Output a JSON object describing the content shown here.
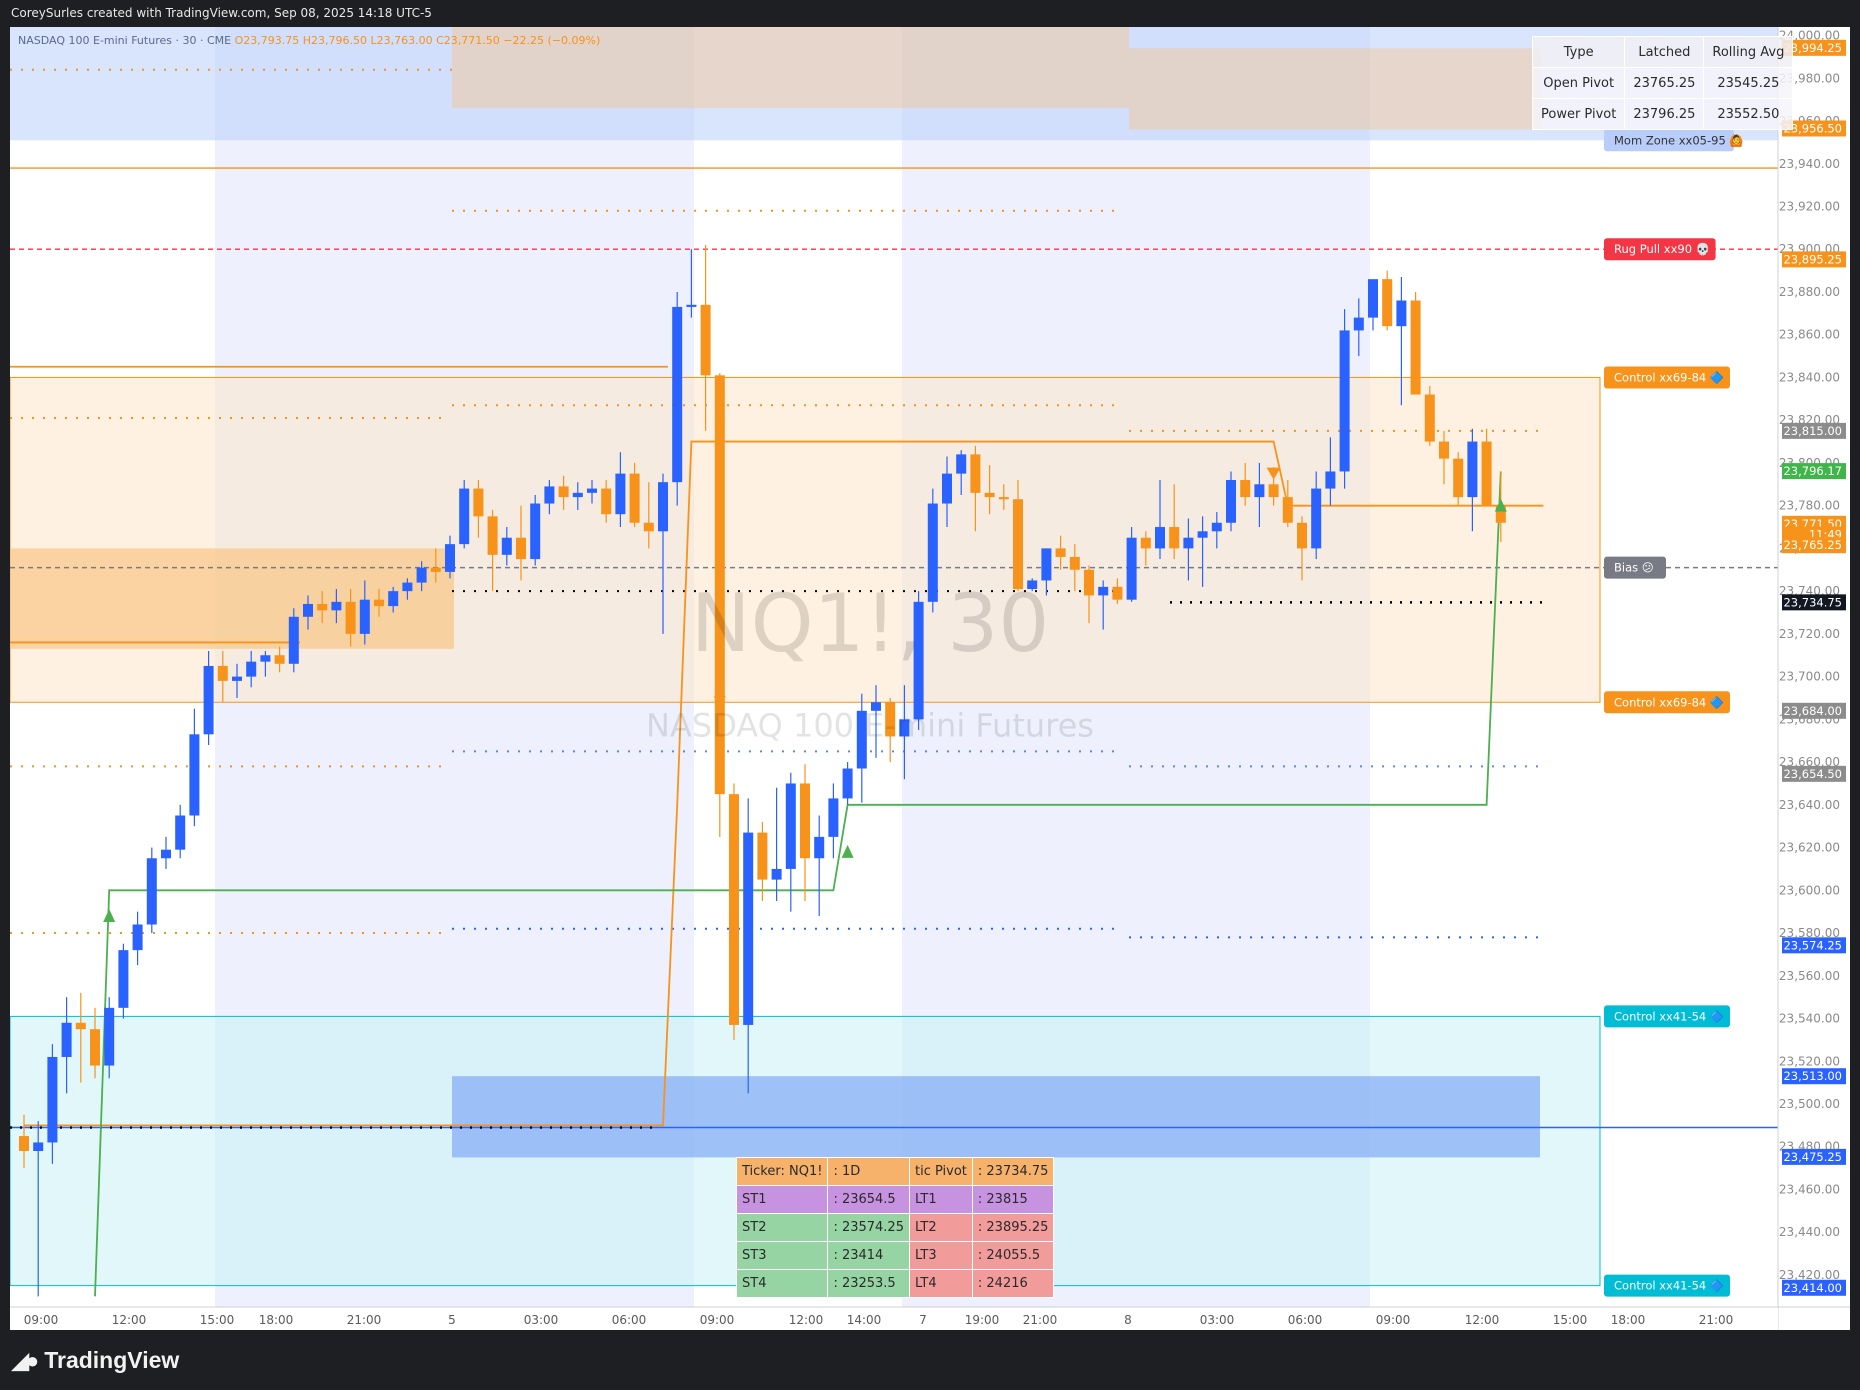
{
  "header": {
    "attribution": "CoreySurles created with TradingView.com, Sep 08, 2025 14:18 UTC-5",
    "brand": "TradingView"
  },
  "legend": {
    "title": "NASDAQ 100 E-mini Futures · 30 · CME",
    "open": "O23,793.75",
    "high": "H23,796.50",
    "low": "L23,763.00",
    "close": "C23,771.50",
    "change": "−22.25 (−0.09%)"
  },
  "watermark": {
    "symbol": "NQ1!, 30",
    "name": "NASDAQ 100 E-mini Futures"
  },
  "pivot_table": {
    "headers": [
      "Type",
      "Latched",
      "Rolling Avg"
    ],
    "rows": [
      [
        "Open Pivot",
        "23765.25",
        "23545.25"
      ],
      [
        "Power Pivot",
        "23796.25",
        "23552.50"
      ]
    ]
  },
  "levels_table": {
    "rows": [
      [
        "Ticker: NQ1!",
        ": 1D",
        "tic Pivot",
        ": 23734.75"
      ],
      [
        "ST1",
        ": 23654.5",
        "LT1",
        ": 23815"
      ],
      [
        "ST2",
        ": 23574.25",
        "LT2",
        ": 23895.25"
      ],
      [
        "ST3",
        ": 23414",
        "LT3",
        ": 24055.5"
      ],
      [
        "ST4",
        ": 23253.5",
        "LT4",
        ": 24216"
      ]
    ]
  },
  "colors": {
    "up": "#2962ff",
    "down": "#f7931a",
    "orange_line": "#f7931a",
    "green_line": "#4caf50",
    "red_dash": "#f23645",
    "cyan": "#00bcd4",
    "blue_line": "#2962ff"
  },
  "chart_data": {
    "type": "candlestick",
    "interval": "30",
    "ylim": [
      23405,
      24004
    ],
    "y_ticks": [
      23420,
      23440,
      23460,
      23480,
      23500,
      23520,
      23540,
      23560,
      23580,
      23600,
      23620,
      23640,
      23660,
      23680,
      23700,
      23720,
      23740,
      23760,
      23780,
      23800,
      23820,
      23840,
      23860,
      23880,
      23900,
      23920,
      23940,
      23960,
      23980,
      24000
    ],
    "x_tick_labels": [
      "09:00",
      "12:00",
      "15:00",
      "18:00",
      "21:00",
      "5",
      "03:00",
      "06:00",
      "09:00",
      "12:00",
      "14:00",
      "7",
      "19:00",
      "21:00",
      "8",
      "03:00",
      "06:00",
      "09:00",
      "12:00",
      "15:00",
      "18:00",
      "21:00"
    ],
    "price_labels": [
      {
        "text": "23,994.25",
        "value": 23994.25,
        "color": "#f7931a"
      },
      {
        "text": "23,956.50",
        "value": 23956.5,
        "color": "#f7931a"
      },
      {
        "text": "23,895.25",
        "value": 23895.25,
        "color": "#f7931a"
      },
      {
        "text": "23,815.00",
        "value": 23815.0,
        "color": "#8c8c8c"
      },
      {
        "text": "23,796.17",
        "value": 23796.17,
        "color": "#3fb54a"
      },
      {
        "text": "23,771.50",
        "value": 23771.5,
        "color": "#f7931a"
      },
      {
        "text": "11:49",
        "value": 23766.5,
        "color": "#f7931a"
      },
      {
        "text": "23,765.25",
        "value": 23761.5,
        "color": "#f7931a"
      },
      {
        "text": "23,734.75",
        "value": 23734.75,
        "color": "#131722"
      },
      {
        "text": "23,684.00",
        "value": 23684.0,
        "color": "#8c8c8c"
      },
      {
        "text": "23,654.50",
        "value": 23654.5,
        "color": "#8c8c8c"
      },
      {
        "text": "23,574.25",
        "value": 23574.25,
        "color": "#2962ff"
      },
      {
        "text": "23,513.00",
        "value": 23513.0,
        "color": "#2962ff"
      },
      {
        "text": "23,475.25",
        "value": 23475.25,
        "color": "#2962ff"
      },
      {
        "text": "23,414.00",
        "value": 23414.0,
        "color": "#2962ff"
      }
    ],
    "level_labels": [
      {
        "text": "Mom Zone xx05-95",
        "value": 23951,
        "color": "#b9cdfb",
        "icon": "🙆"
      },
      {
        "text": "Rug Pull xx90",
        "value": 23900,
        "color": "#f23645",
        "icon": "💀"
      },
      {
        "text": "Control xx69-84",
        "value": 23840,
        "color": "#f7931a",
        "icon": "🔷"
      },
      {
        "text": "Bias",
        "value": 23751,
        "color": "#787b86",
        "icon": "😕"
      },
      {
        "text": "Control xx69-84",
        "value": 23688,
        "color": "#f7931a",
        "icon": "🔷"
      },
      {
        "text": "Control xx41-54",
        "value": 23541,
        "color": "#00bcd4",
        "icon": "🔷"
      },
      {
        "text": "Control xx41-54",
        "value": 23415,
        "color": "#00bcd4",
        "icon": "🔷"
      }
    ],
    "candles": [
      [
        23485,
        23495,
        23470,
        23478
      ],
      [
        23478,
        23492,
        23410,
        23482
      ],
      [
        23482,
        23528,
        23472,
        23522
      ],
      [
        23522,
        23550,
        23505,
        23538
      ],
      [
        23538,
        23552,
        23510,
        23535
      ],
      [
        23535,
        23545,
        23512,
        23518
      ],
      [
        23518,
        23550,
        23512,
        23545
      ],
      [
        23545,
        23575,
        23540,
        23572
      ],
      [
        23572,
        23590,
        23565,
        23584
      ],
      [
        23584,
        23620,
        23580,
        23615
      ],
      [
        23615,
        23625,
        23610,
        23619
      ],
      [
        23619,
        23640,
        23615,
        23635
      ],
      [
        23635,
        23685,
        23630,
        23673
      ],
      [
        23673,
        23712,
        23668,
        23705
      ],
      [
        23705,
        23712,
        23688,
        23698
      ],
      [
        23698,
        23706,
        23690,
        23700
      ],
      [
        23700,
        23712,
        23695,
        23707
      ],
      [
        23707,
        23712,
        23700,
        23710
      ],
      [
        23710,
        23714,
        23702,
        23706
      ],
      [
        23706,
        23732,
        23702,
        23728
      ],
      [
        23728,
        23738,
        23722,
        23734
      ],
      [
        23734,
        23740,
        23725,
        23731
      ],
      [
        23731,
        23741,
        23725,
        23735
      ],
      [
        23735,
        23741,
        23714,
        23720
      ],
      [
        23720,
        23745,
        23715,
        23736
      ],
      [
        23736,
        23741,
        23728,
        23733
      ],
      [
        23733,
        23742,
        23730,
        23740
      ],
      [
        23740,
        23746,
        23736,
        23744
      ],
      [
        23744,
        23754,
        23740,
        23751
      ],
      [
        23751,
        23760,
        23744,
        23749
      ],
      [
        23749,
        23766,
        23746,
        23762
      ],
      [
        23762,
        23792,
        23760,
        23788
      ],
      [
        23788,
        23792,
        23765,
        23775
      ],
      [
        23775,
        23778,
        23740,
        23757
      ],
      [
        23757,
        23770,
        23752,
        23765
      ],
      [
        23765,
        23780,
        23745,
        23755
      ],
      [
        23755,
        23785,
        23752,
        23781
      ],
      [
        23781,
        23792,
        23776,
        23789
      ],
      [
        23789,
        23794,
        23778,
        23784
      ],
      [
        23784,
        23791,
        23778,
        23786
      ],
      [
        23786,
        23792,
        23781,
        23788
      ],
      [
        23788,
        23792,
        23772,
        23776
      ],
      [
        23776,
        23805,
        23770,
        23795
      ],
      [
        23795,
        23800,
        23770,
        23772
      ],
      [
        23772,
        23791,
        23760,
        23768
      ],
      [
        23768,
        23795,
        23720,
        23791
      ],
      [
        23791,
        23880,
        23780,
        23873
      ],
      [
        23873,
        23900,
        23868,
        23874
      ],
      [
        23874,
        23902,
        23815,
        23841
      ],
      [
        23841,
        23842,
        23625,
        23645
      ],
      [
        23645,
        23650,
        23530,
        23537
      ],
      [
        23537,
        23643,
        23505,
        23627
      ],
      [
        23627,
        23632,
        23595,
        23605
      ],
      [
        23605,
        23648,
        23595,
        23610
      ],
      [
        23610,
        23655,
        23590,
        23650
      ],
      [
        23650,
        23659,
        23595,
        23615
      ],
      [
        23615,
        23635,
        23588,
        23625
      ],
      [
        23625,
        23650,
        23615,
        23643
      ],
      [
        23643,
        23660,
        23640,
        23657
      ],
      [
        23657,
        23692,
        23641,
        23684
      ],
      [
        23684,
        23696,
        23662,
        23688
      ],
      [
        23688,
        23690,
        23660,
        23672
      ],
      [
        23672,
        23696,
        23652,
        23680
      ],
      [
        23680,
        23740,
        23675,
        23735
      ],
      [
        23735,
        23788,
        23730,
        23781
      ],
      [
        23781,
        23803,
        23770,
        23795
      ],
      [
        23795,
        23806,
        23785,
        23804
      ],
      [
        23804,
        23808,
        23768,
        23786
      ],
      [
        23786,
        23799,
        23776,
        23784
      ],
      [
        23784,
        23790,
        23778,
        23783
      ],
      [
        23783,
        23792,
        23740,
        23741
      ],
      [
        23741,
        23746,
        23740,
        23745
      ],
      [
        23745,
        23760,
        23738,
        23760
      ],
      [
        23760,
        23766,
        23750,
        23756
      ],
      [
        23756,
        23762,
        23740,
        23750
      ],
      [
        23750,
        23752,
        23725,
        23738
      ],
      [
        23738,
        23745,
        23722,
        23742
      ],
      [
        23742,
        23746,
        23734,
        23736
      ],
      [
        23736,
        23770,
        23735,
        23765
      ],
      [
        23765,
        23768,
        23752,
        23760
      ],
      [
        23760,
        23792,
        23755,
        23770
      ],
      [
        23770,
        23790,
        23755,
        23760
      ],
      [
        23760,
        23774,
        23745,
        23765
      ],
      [
        23765,
        23775,
        23742,
        23768
      ],
      [
        23768,
        23777,
        23760,
        23772
      ],
      [
        23772,
        23796,
        23768,
        23792
      ],
      [
        23792,
        23800,
        23780,
        23784
      ],
      [
        23784,
        23800,
        23770,
        23790
      ],
      [
        23790,
        23798,
        23780,
        23784
      ],
      [
        23784,
        23792,
        23770,
        23772
      ],
      [
        23772,
        23775,
        23745,
        23760
      ],
      [
        23760,
        23796,
        23755,
        23788
      ],
      [
        23788,
        23812,
        23780,
        23796
      ],
      [
        23796,
        23872,
        23788,
        23862
      ],
      [
        23862,
        23877,
        23850,
        23868
      ],
      [
        23868,
        23883,
        23862,
        23886
      ],
      [
        23886,
        23890,
        23862,
        23864
      ],
      [
        23864,
        23887,
        23827,
        23876
      ],
      [
        23876,
        23880,
        23832,
        23832
      ],
      [
        23832,
        23836,
        23808,
        23810
      ],
      [
        23810,
        23815,
        23790,
        23802
      ],
      [
        23802,
        23805,
        23780,
        23784
      ],
      [
        23784,
        23816,
        23768,
        23810
      ],
      [
        23810,
        23816,
        23793,
        23780
      ],
      [
        23780,
        23796,
        23763,
        23772
      ]
    ],
    "orange_step_line": [
      [
        0,
        23490
      ],
      [
        45,
        23490
      ],
      [
        46,
        23640
      ],
      [
        47,
        23810
      ],
      [
        88,
        23810
      ],
      [
        89,
        23780
      ],
      [
        107,
        23780
      ]
    ],
    "green_step_line": [
      [
        5,
        23410
      ],
      [
        6,
        23600
      ],
      [
        57,
        23600
      ],
      [
        58,
        23640
      ],
      [
        103,
        23640
      ],
      [
        104,
        23796
      ]
    ],
    "bands": [
      {
        "name": "mom-zone",
        "from": 23951,
        "to": 24004,
        "color": "#b9cdfb"
      },
      {
        "name": "control-upper",
        "from": 23688,
        "to": 23840,
        "color": "#fde6c8"
      },
      {
        "name": "control-lower",
        "from": 23415,
        "to": 23541,
        "color": "#c8f0f5"
      },
      {
        "name": "blue-box",
        "from": 23475,
        "to": 23513,
        "color": "#82aaf7"
      }
    ],
    "horizontal_lines": [
      {
        "value": 23938,
        "color": "#f7931a",
        "style": "solid"
      },
      {
        "value": 23900,
        "color": "#f23645",
        "style": "dashed"
      },
      {
        "value": 23751,
        "color": "#787b86",
        "style": "dashed"
      },
      {
        "value": 23734.75,
        "color": "#000000",
        "style": "dotted"
      },
      {
        "value": 23489,
        "color": "#2962ff",
        "style": "solid"
      }
    ]
  }
}
